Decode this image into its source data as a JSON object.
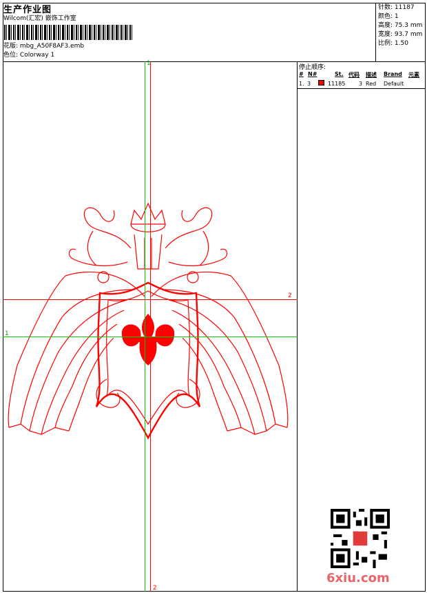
{
  "header": {
    "title": "生产作业图",
    "maker": "Wilcom(汇宏) 嵌饰工作室",
    "design_label": "花版:",
    "design_value": "mbg_A50F8AF3.emb",
    "colorway_label": "色位:",
    "colorway_value": "Colorway 1"
  },
  "stats": [
    {
      "label": "针数:",
      "value": "11187"
    },
    {
      "label": "颜色:",
      "value": "1"
    },
    {
      "label": "高度:",
      "value": "75.3 mm"
    },
    {
      "label": "宽度:",
      "value": "93.7 mm"
    },
    {
      "label": "比例:",
      "value": "1.50"
    }
  ],
  "stop_sequence": {
    "title": "停止顺序:",
    "columns": [
      "#",
      "N#",
      "St.",
      "代码",
      "描述",
      "Brand",
      "元素"
    ],
    "rows": [
      {
        "index": "1.",
        "needle": "3",
        "stitches": "11185",
        "code": "3",
        "description": "Red",
        "brand": "Default",
        "color": "#ff0000"
      }
    ]
  },
  "guides": {
    "v_top": "1",
    "v_bottom": "2",
    "h_left": "1",
    "h_right": "2"
  },
  "colors": {
    "thread": "#ff0000",
    "guide_green": "#00cc00",
    "guide_red": "#ff0000"
  },
  "watermark": "6xiu.com"
}
